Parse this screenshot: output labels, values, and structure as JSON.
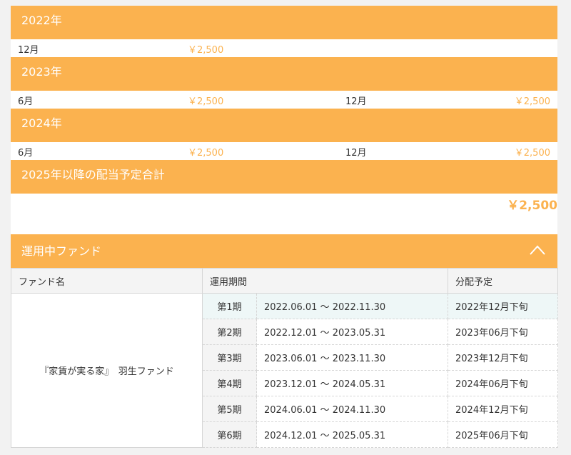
{
  "years": [
    {
      "label": "2022年",
      "entries": [
        {
          "month": "12月",
          "amount": "￥2,500"
        }
      ]
    },
    {
      "label": "2023年",
      "entries": [
        {
          "month": "6月",
          "amount": "￥2,500"
        },
        {
          "month": "12月",
          "amount": "￥2,500"
        }
      ]
    },
    {
      "label": "2024年",
      "entries": [
        {
          "month": "6月",
          "amount": "￥2,500"
        },
        {
          "month": "12月",
          "amount": "￥2,500"
        }
      ]
    }
  ],
  "total": {
    "label": "2025年以降の配当予定合計",
    "amount": "￥2,500"
  },
  "fund_section": {
    "title": "運用中ファンド",
    "columns": [
      "ファンド名",
      "運用期間",
      "分配予定"
    ],
    "fund_name": "『家賃が実る家』　羽生ファンド",
    "rows": [
      {
        "period": "第1期",
        "range": "2022.06.01 〜 2022.11.30",
        "schedule": "2022年12月下旬"
      },
      {
        "period": "第2期",
        "range": "2022.12.01 〜 2023.05.31",
        "schedule": "2023年06月下旬"
      },
      {
        "period": "第3期",
        "range": "2023.06.01 〜 2023.11.30",
        "schedule": "2023年12月下旬"
      },
      {
        "period": "第4期",
        "range": "2023.12.01 〜 2024.05.31",
        "schedule": "2024年06月下旬"
      },
      {
        "period": "第5期",
        "range": "2024.06.01 〜 2024.11.30",
        "schedule": "2024年12月下旬"
      },
      {
        "period": "第6期",
        "range": "2024.12.01 〜 2025.05.31",
        "schedule": "2025年06月下旬"
      }
    ]
  },
  "colors": {
    "accent": "#fbb24f",
    "header_bg": "#f4f4f4",
    "highlight_row": "#eef7f7"
  }
}
